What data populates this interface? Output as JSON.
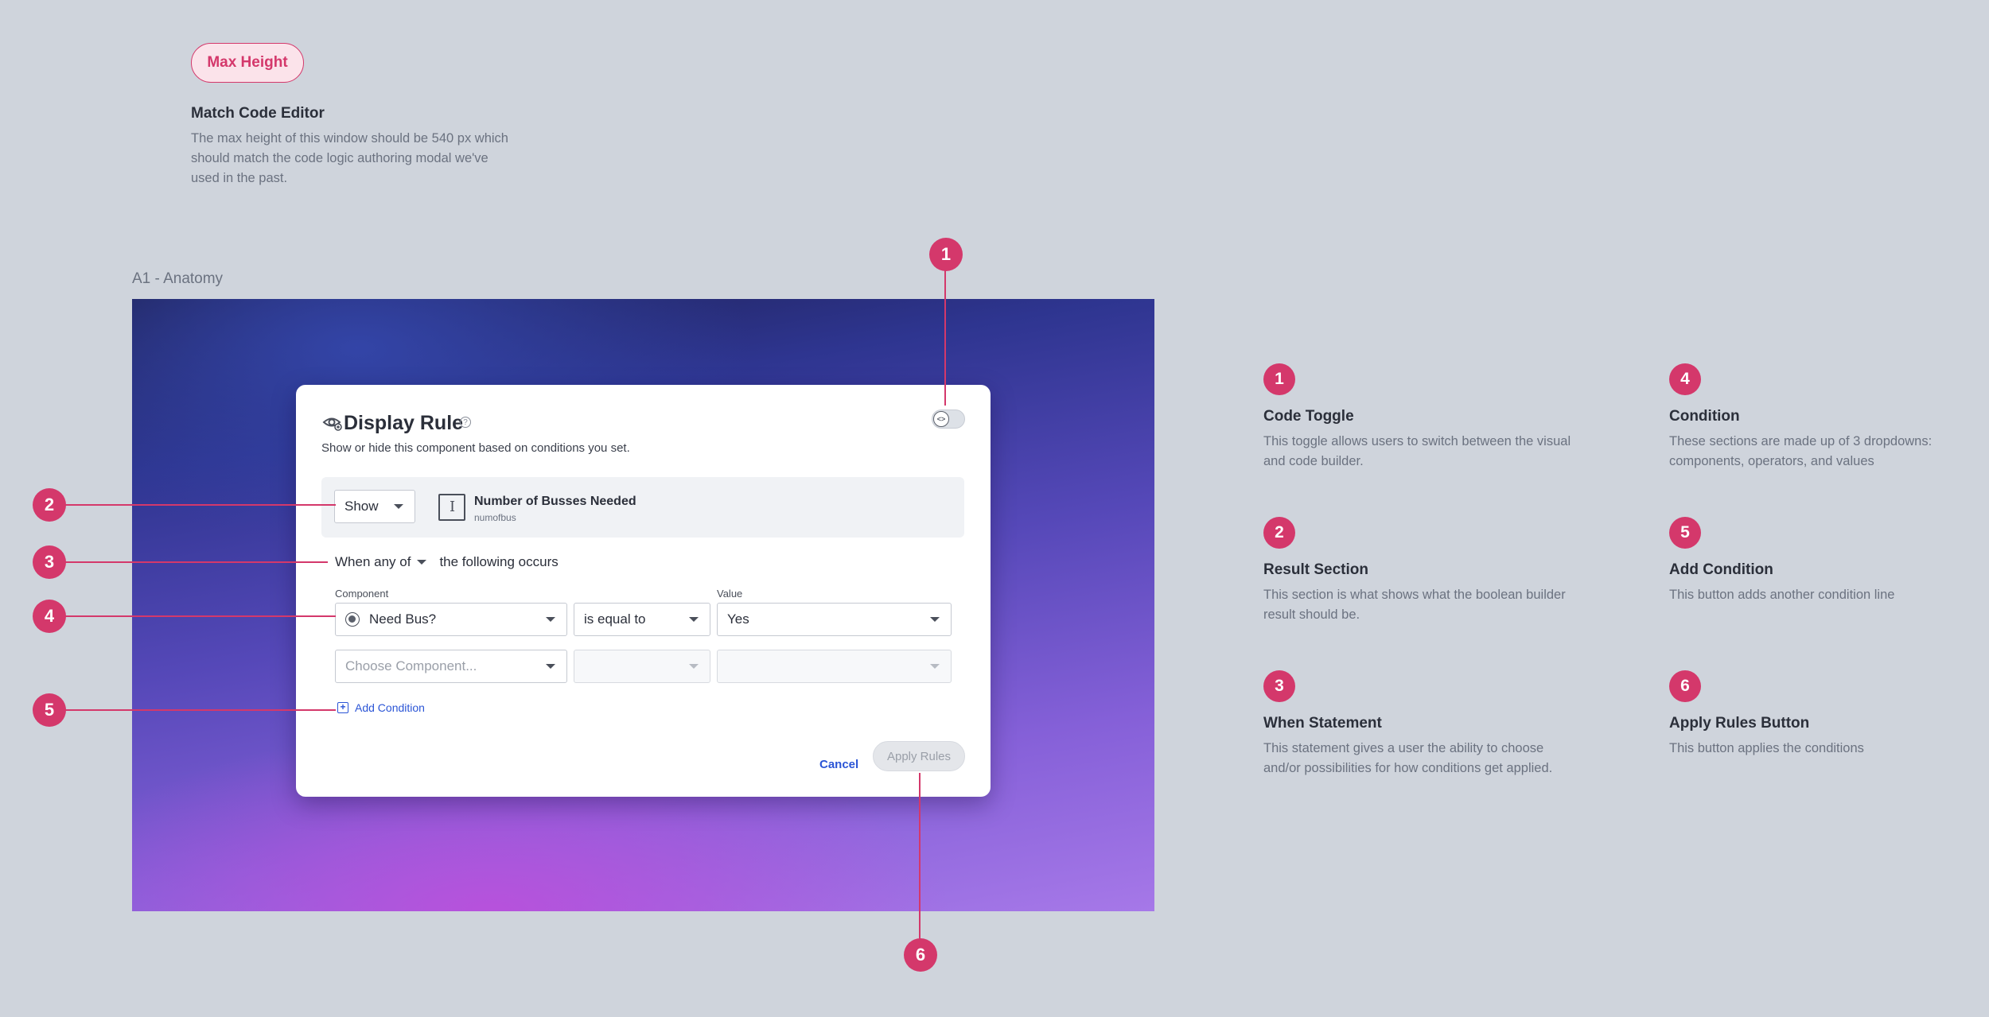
{
  "note": {
    "pill_label": "Max Height",
    "title": "Match Code Editor",
    "body": "The max height of this window should be 540 px which should match the code logic authoring modal we've used in the past."
  },
  "frame_label": "A1 - Anatomy",
  "dialog": {
    "title": "Display Rule",
    "help_glyph": "?",
    "subtitle": "Show or hide this component based on conditions you set.",
    "toggle_glyph": "<>",
    "result": {
      "action_value": "Show",
      "field_name": "Number of Busses Needed",
      "field_key": "numofbus"
    },
    "when": {
      "prefix": "When any of",
      "suffix": "the following occurs"
    },
    "columns": {
      "component": "Component",
      "value": "Value"
    },
    "conditions": [
      {
        "component": "Need Bus?",
        "operator": "is equal to",
        "value": "Yes"
      },
      {
        "component_placeholder": "Choose Component...",
        "operator": "",
        "value": ""
      }
    ],
    "add_condition": "Add Condition",
    "cancel": "Cancel",
    "apply": "Apply Rules"
  },
  "callouts": [
    "1",
    "2",
    "3",
    "4",
    "5",
    "6"
  ],
  "legend": [
    {
      "number": "1",
      "title": "Code Toggle",
      "description": "This toggle allows users to switch between the visual and code builder."
    },
    {
      "number": "2",
      "title": "Result Section",
      "description": "This section is what shows what the boolean builder result should be."
    },
    {
      "number": "3",
      "title": "When Statement",
      "description": "This statement gives a user the ability to choose and/or possibilities for how conditions get applied."
    },
    {
      "number": "4",
      "title": "Condition",
      "description": "These sections are made up of 3 dropdowns: components, operators, and values"
    },
    {
      "number": "5",
      "title": "Add Condition",
      "description": "This button adds another condition line"
    },
    {
      "number": "6",
      "title": "Apply Rules Button",
      "description": "This button applies the conditions"
    }
  ],
  "colors": {
    "accent": "#d4386b",
    "link": "#2b55d6",
    "background": "#cfd4dc"
  }
}
